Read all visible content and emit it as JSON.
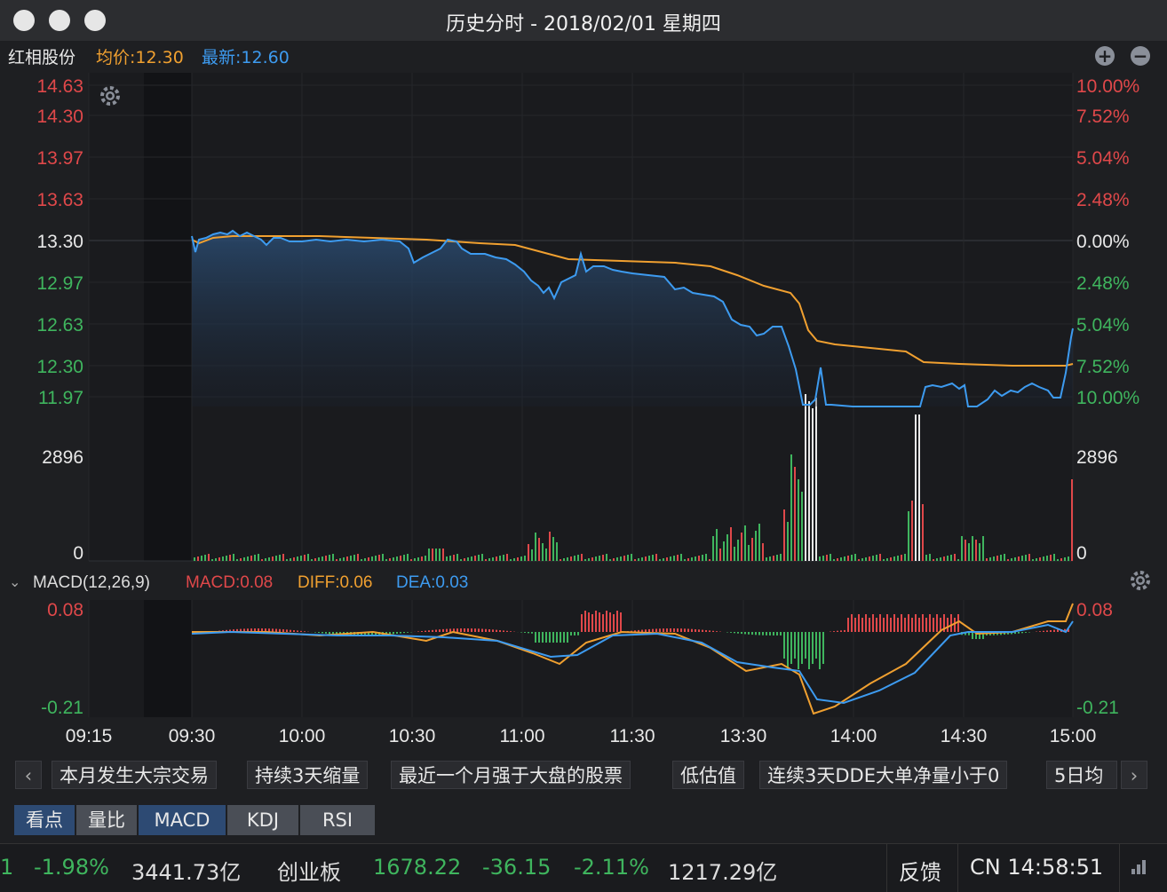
{
  "window": {
    "title": "历史分时 - 2018/02/01 星期四"
  },
  "info": {
    "stock_name": "红相股份",
    "avg_price": "均价:12.30",
    "latest_price": "最新:12.60",
    "avg_color": "#f0a030",
    "latest_color": "#3d9bf0"
  },
  "price_axis": {
    "left": [
      "14.63",
      "14.30",
      "13.97",
      "13.63",
      "13.30",
      "12.97",
      "12.63",
      "12.30",
      "11.97"
    ],
    "right": [
      "10.00%",
      "7.52%",
      "5.04%",
      "2.48%",
      "0.00%",
      "2.48%",
      "5.04%",
      "7.52%",
      "10.00%"
    ]
  },
  "volume_axis": {
    "max_left": "2896",
    "min_left": "0",
    "max_right": "2896",
    "min_right": "0"
  },
  "macd_header": {
    "title": "MACD(12,26,9)",
    "macd": "MACD:0.08",
    "diff": "DIFF:0.06",
    "dea": "DEA:0.03"
  },
  "macd_axis": {
    "top_left": "0.08",
    "bottom_left": "-0.21",
    "top_right": "0.08",
    "bottom_right": "-0.21"
  },
  "time_axis": [
    "09:15",
    "09:30",
    "10:00",
    "10:30",
    "11:00",
    "11:30",
    "13:30",
    "14:00",
    "14:30",
    "15:00"
  ],
  "tags": [
    "本月发生大宗交易",
    "持续3天缩量",
    "最近一个月强于大盘的股票",
    "低估值",
    "连续3天DDE大单净量小于0",
    "5日均"
  ],
  "tabs": [
    "看点",
    "量比",
    "MACD",
    "KDJ",
    "RSI"
  ],
  "status": {
    "s1": "1",
    "s2": "-1.98%",
    "s3": "3441.73亿",
    "s4": "创业板",
    "s5": "1678.22",
    "s6": "-36.15",
    "s7": "-2.11%",
    "s8": "1217.29亿",
    "feedback": "反馈",
    "clock": "CN 14:58:51"
  },
  "colors": {
    "red": "#e0484a",
    "green": "#3fb55e",
    "blue": "#3d9bf0",
    "orange": "#f0a030"
  }
}
